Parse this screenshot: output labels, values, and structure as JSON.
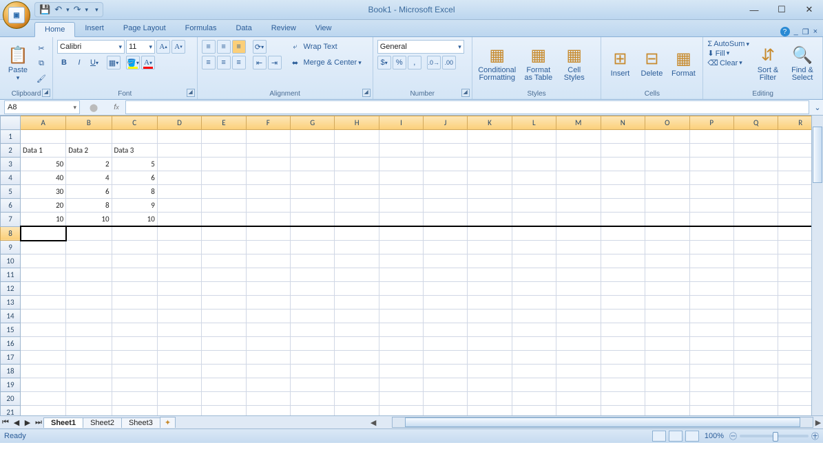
{
  "title": "Book1 - Microsoft Excel",
  "qat": {
    "save": "💾",
    "undo": "↶",
    "redo": "↷"
  },
  "tabs": [
    "Home",
    "Insert",
    "Page Layout",
    "Formulas",
    "Data",
    "Review",
    "View"
  ],
  "activeTab": "Home",
  "ribbon": {
    "clipboard": {
      "label": "Clipboard",
      "paste": "Paste"
    },
    "font": {
      "label": "Font",
      "name": "Calibri",
      "size": "11"
    },
    "alignment": {
      "label": "Alignment",
      "wrap": "Wrap Text",
      "merge": "Merge & Center"
    },
    "number": {
      "label": "Number",
      "format": "General"
    },
    "styles": {
      "label": "Styles",
      "cond": "Conditional\nFormatting",
      "table": "Format\nas Table",
      "cell": "Cell\nStyles"
    },
    "cells": {
      "label": "Cells",
      "insert": "Insert",
      "delete": "Delete",
      "format": "Format"
    },
    "editing": {
      "label": "Editing",
      "autosum": "AutoSum",
      "fill": "Fill",
      "clear": "Clear",
      "sort": "Sort &\nFilter",
      "find": "Find &\nSelect"
    }
  },
  "namebox": "A8",
  "columns": [
    "A",
    "B",
    "C",
    "D",
    "E",
    "F",
    "G",
    "H",
    "I",
    "J",
    "K",
    "L",
    "M",
    "N",
    "O",
    "P",
    "Q",
    "R"
  ],
  "rowCount": 21,
  "selectedCell": {
    "row": 8,
    "col": 1
  },
  "cells": {
    "2": {
      "1": "Data 1",
      "2": "Data 2",
      "3": "Data 3"
    },
    "3": {
      "1": "50",
      "2": "2",
      "3": "5"
    },
    "4": {
      "1": "40",
      "2": "4",
      "3": "6"
    },
    "5": {
      "1": "30",
      "2": "6",
      "3": "8"
    },
    "6": {
      "1": "20",
      "2": "8",
      "3": "9"
    },
    "7": {
      "1": "10",
      "2": "10",
      "3": "10"
    }
  },
  "textCells": [
    "2"
  ],
  "thickBottomRow": 7,
  "sheetTabs": [
    "Sheet1",
    "Sheet2",
    "Sheet3"
  ],
  "activeSheet": "Sheet1",
  "status": "Ready",
  "zoom": "100%"
}
